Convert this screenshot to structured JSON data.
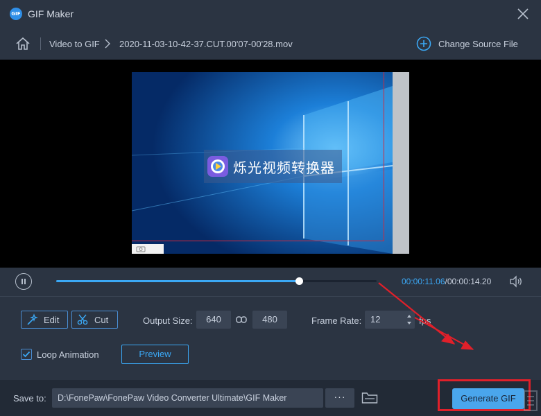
{
  "window": {
    "logo_text": "GIF",
    "title": "GIF Maker"
  },
  "nav": {
    "crumb_section": "Video to GIF",
    "crumb_file": "2020-11-03-10-42-37.CUT.00'07-00'28.mov",
    "change_source_label": "Change Source File"
  },
  "preview": {
    "watermark_text": "烁光视频转换器"
  },
  "player": {
    "progress_fraction": 0.757,
    "current_time": "00:00:11.06",
    "separator": "/",
    "total_time": "00:00:14.20"
  },
  "controls": {
    "edit_label": "Edit",
    "cut_label": "Cut",
    "output_size_label": "Output Size:",
    "width_value": "640",
    "height_value": "480",
    "frame_rate_label": "Frame Rate:",
    "frame_rate_value": "12",
    "fps_label": "fps",
    "loop_label": "Loop Animation",
    "loop_checked": true,
    "preview_label": "Preview"
  },
  "footer": {
    "save_to_label": "Save to:",
    "save_path": "D:\\FonePaw\\FonePaw Video Converter Ultimate\\GIF Maker",
    "more_label": "···",
    "generate_label": "Generate GIF"
  },
  "colors": {
    "accent": "#3ba8f5",
    "annotation_red": "#e0202a",
    "background": "#2b3442"
  }
}
